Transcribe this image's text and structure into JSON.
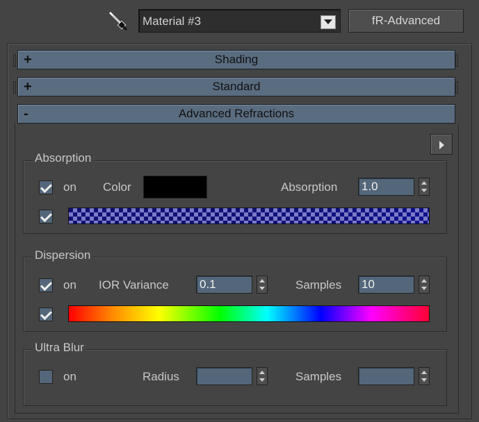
{
  "toolbar": {
    "picker_icon": "eyedropper-icon",
    "material_name": "Material #3",
    "material_type_button": "fR-Advanced"
  },
  "rollouts": [
    {
      "sign": "+",
      "title": "Shading"
    },
    {
      "sign": "+",
      "title": "Standard"
    },
    {
      "sign": "-",
      "title": "Advanced Refractions"
    }
  ],
  "absorption": {
    "group_label": "Absorption",
    "on_checked": true,
    "on_label": "on",
    "color_label": "Color",
    "color_value": "#000000",
    "absorption_label": "Absorption",
    "absorption_value": "1.0",
    "map_checked": true
  },
  "dispersion": {
    "group_label": "Dispersion",
    "on_checked": true,
    "on_label": "on",
    "ior_label": "IOR Variance",
    "ior_value": "0.1",
    "samples_label": "Samples",
    "samples_value": "10",
    "map_checked": true
  },
  "ultra_blur": {
    "group_label": "Ultra Blur",
    "on_checked": false,
    "on_label": "on",
    "radius_label": "Radius",
    "radius_value": "",
    "samples_label": "Samples",
    "samples_value": ""
  },
  "colors": {
    "background": "#444444",
    "rollout": "#5a6c80",
    "field": "#546679"
  }
}
